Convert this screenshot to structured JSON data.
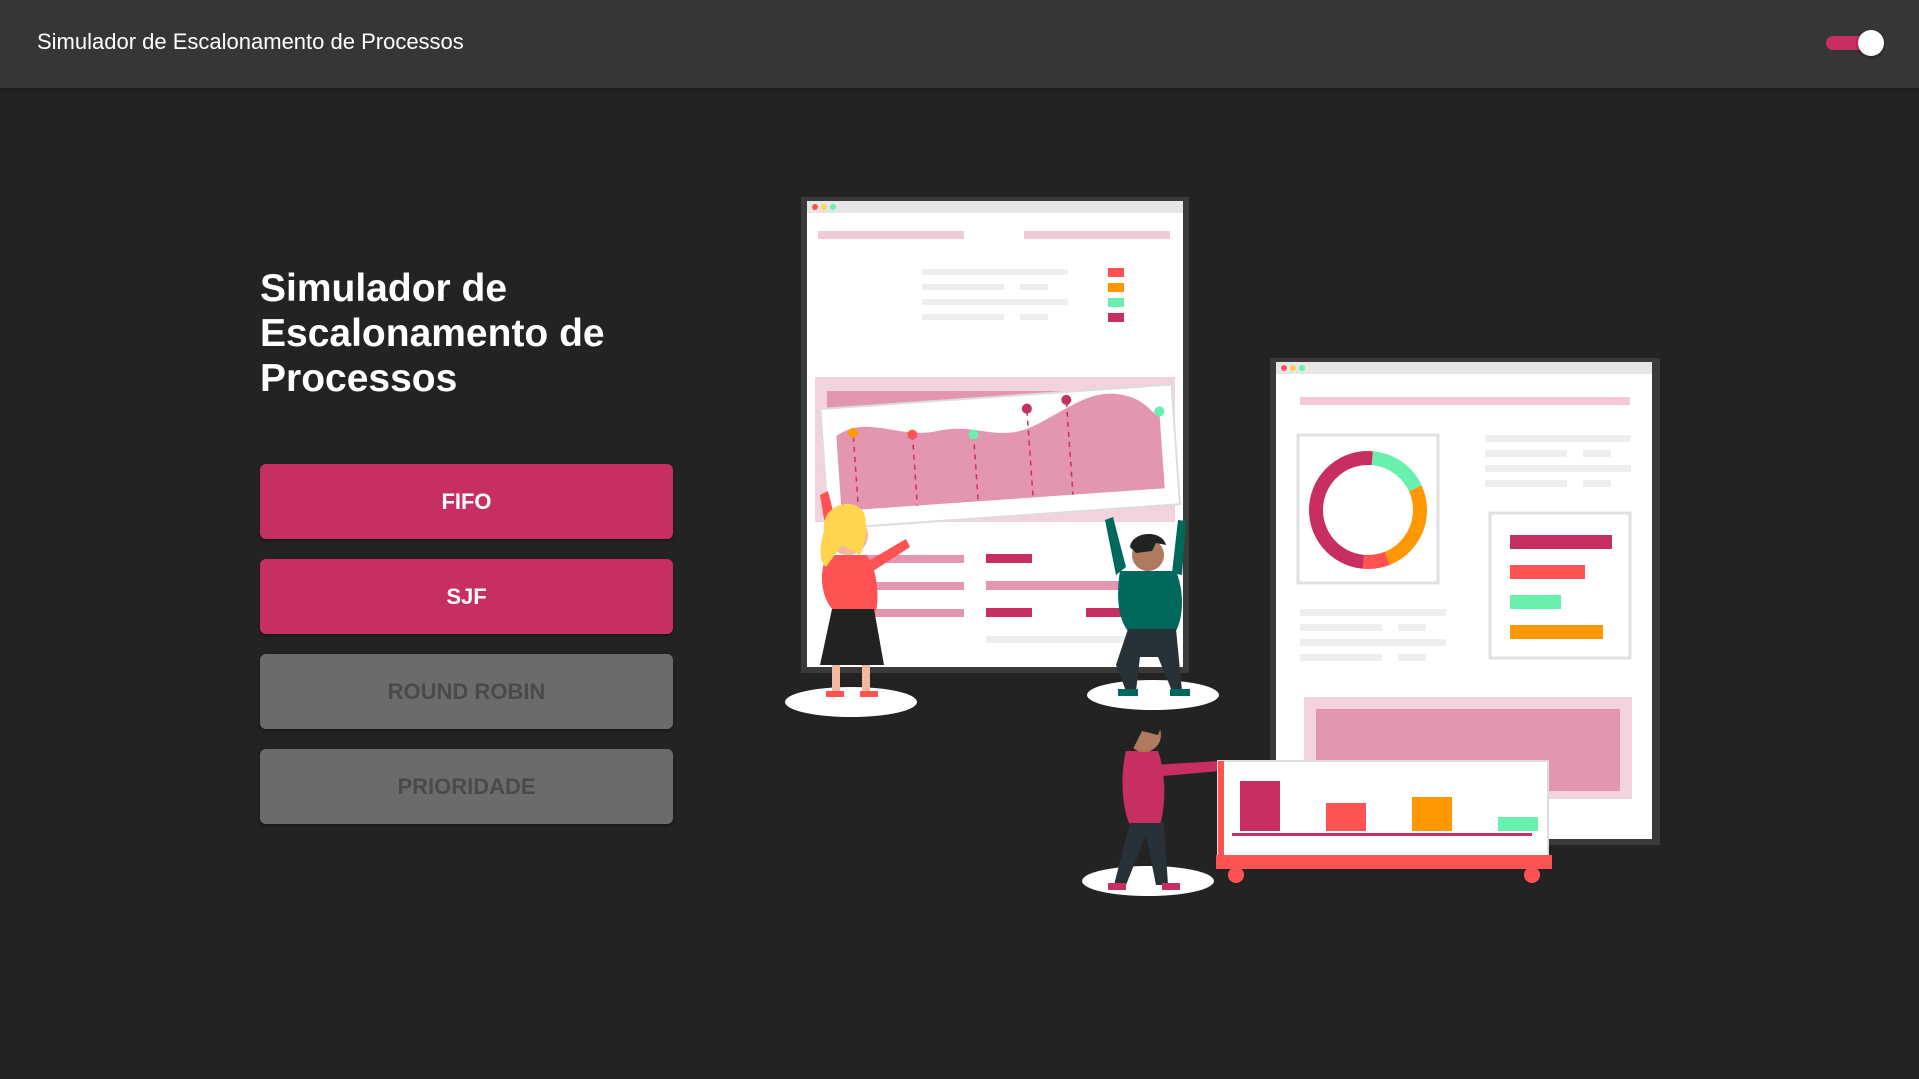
{
  "appbar": {
    "title": "Simulador de Escalonamento de Processos",
    "theme_toggle_on": true
  },
  "main": {
    "heading": "Simulador de Escalonamento de Processos",
    "buttons": [
      {
        "label": "FIFO",
        "enabled": true
      },
      {
        "label": "SJF",
        "enabled": true
      },
      {
        "label": "ROUND ROBIN",
        "enabled": false
      },
      {
        "label": "PRIORIDADE",
        "enabled": false
      }
    ]
  },
  "colors": {
    "accent": "#c72f60",
    "background": "#232323",
    "appbar": "#363636",
    "disabled_button": "#6b6b6b",
    "illustration_pink": "#e396b2",
    "illustration_red": "#ff5252",
    "illustration_orange": "#ff9800",
    "illustration_green": "#69f0ae"
  }
}
